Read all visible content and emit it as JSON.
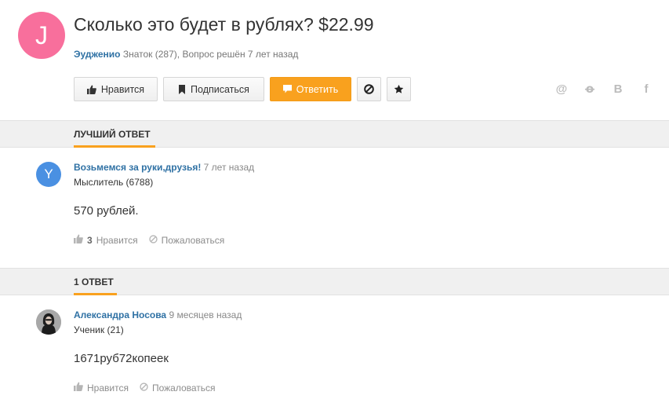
{
  "question": {
    "avatar_letter": "J",
    "avatar_color": "#f86f9c",
    "title": "Сколько это будет в рублях? $22.99",
    "author": "Эудженио",
    "author_info": "Знаток (287), Вопрос решён 7 лет назад"
  },
  "actions": {
    "like_label": "Нравится",
    "subscribe_label": "Подписаться",
    "answer_label": "Ответить",
    "accent_color": "#f9a11e"
  },
  "share": {
    "icons": [
      "mail-at-icon",
      "odnoklassniki-icon",
      "vk-icon",
      "facebook-icon"
    ],
    "mail_glyph": "@",
    "ok_glyph": "ꝋ",
    "vk_glyph": "B",
    "fb_glyph": "f"
  },
  "best_answer_section": {
    "label": "ЛУЧШИЙ ОТВЕТ"
  },
  "best_answer": {
    "avatar_letter": "Y",
    "author": "Возьмемся за руки,друзья!",
    "time": "7 лет назад",
    "rank": "Мыслитель (6788)",
    "text": "570 рублей.",
    "likes_count": "3",
    "like_label": "Нравится",
    "report_label": "Пожаловаться"
  },
  "answers_section": {
    "label": "1 ОТВЕТ"
  },
  "answer": {
    "author": "Александра Носова",
    "time": "9 месяцев назад",
    "rank": "Ученик (21)",
    "text": "1671руб72копеек",
    "like_label": "Нравится",
    "report_label": "Пожаловаться"
  }
}
